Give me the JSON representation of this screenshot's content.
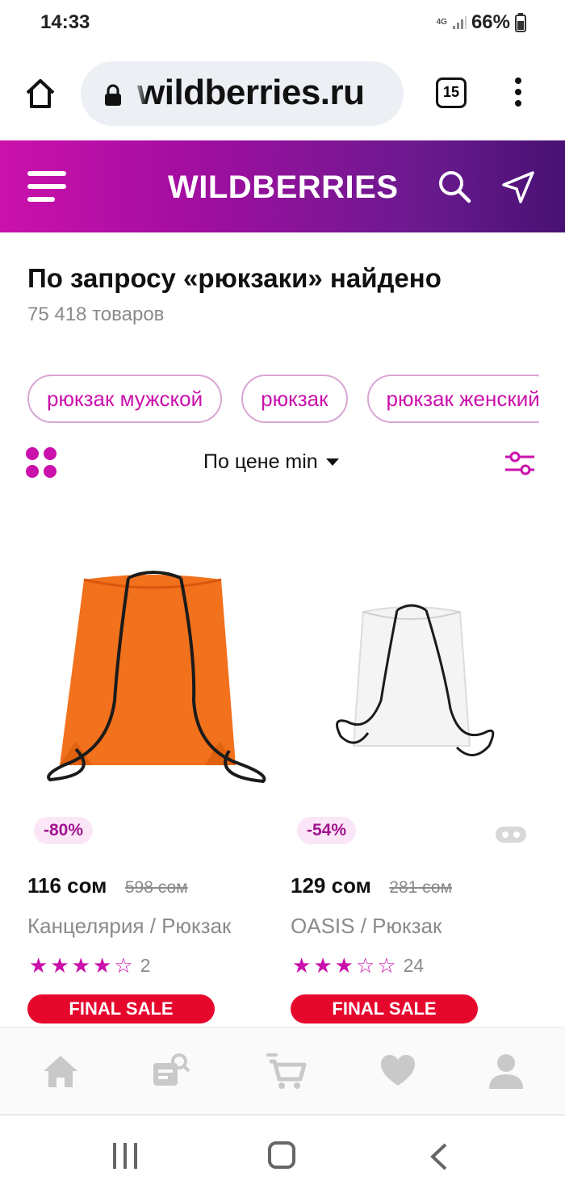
{
  "status_bar": {
    "time": "14:33",
    "network": "4G",
    "battery": "66%"
  },
  "browser": {
    "url": "wildberries.ru",
    "tabs_count": "15"
  },
  "header": {
    "logo": "WILDBERRIES"
  },
  "results": {
    "title": "По запросу «рюкзаки» найдено",
    "count": "75 418 товаров"
  },
  "chips": [
    "рюкзак мужской",
    "рюкзак",
    "рюкзак женский"
  ],
  "toolbar": {
    "sort_label": "По цене min"
  },
  "products": [
    {
      "discount": "-80%",
      "price": "116 сом",
      "old_price": "598 сом",
      "name": "Канцелярия / Рюкзак",
      "rating": 4,
      "reviews": "2",
      "badge": "FINAL SALE",
      "image_color": "#f2711c"
    },
    {
      "discount": "-54%",
      "price": "129 сом",
      "old_price": "281 сом",
      "name": "OASIS / Рюкзак",
      "rating": 3,
      "reviews": "24",
      "badge": "FINAL SALE",
      "image_color": "#f4f4f4"
    }
  ],
  "colors": {
    "brand": "#cb11ab",
    "brand_dark": "#481173",
    "sale": "#e6072d"
  },
  "icons": {
    "nav": [
      "home-icon",
      "catalog-search-icon",
      "cart-icon",
      "heart-icon",
      "profile-icon"
    ]
  }
}
